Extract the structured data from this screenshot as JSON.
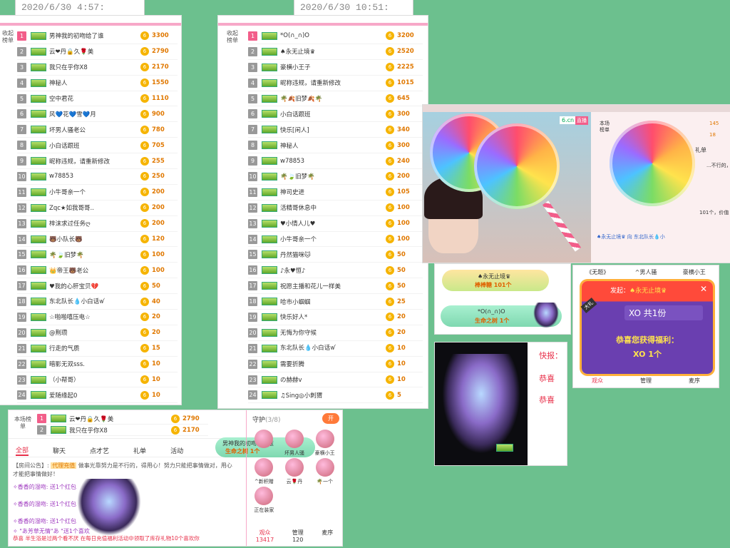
{
  "timestamps": [
    "2020/6/30 4:57:",
    "2020/6/30 10:51:"
  ],
  "rank_left": {
    "side": "收起榜单",
    "rows": [
      {
        "rank": "1",
        "name": "男神我的初吻给了谁",
        "score": "3300"
      },
      {
        "rank": "2",
        "name": "云❤丹🔒久🌹美",
        "score": "2790"
      },
      {
        "rank": "3",
        "name": "我只在乎你X8",
        "score": "2170"
      },
      {
        "rank": "4",
        "name": "神秘人",
        "score": "1550"
      },
      {
        "rank": "5",
        "name": "空中君花",
        "score": "1110"
      },
      {
        "rank": "6",
        "name": "风💙花💙雪💙月",
        "score": "900"
      },
      {
        "rank": "7",
        "name": "坏男人骚老公",
        "score": "780"
      },
      {
        "rank": "8",
        "name": "小白话跟班",
        "score": "705"
      },
      {
        "rank": "9",
        "name": "昵称违规，请重新修改",
        "score": "255"
      },
      {
        "rank": "10",
        "name": "w78853",
        "score": "250"
      },
      {
        "rank": "11",
        "name": "小牛哥亲一个",
        "score": "200"
      },
      {
        "rank": "12",
        "name": "Zqc★如我哥哥..",
        "score": "200"
      },
      {
        "rank": "13",
        "name": "梓沫求过任务ღ",
        "score": "200"
      },
      {
        "rank": "14",
        "name": "🐻小队长🐻",
        "score": "120"
      },
      {
        "rank": "15",
        "name": "🌴🍃旧梦🌴",
        "score": "100"
      },
      {
        "rank": "16",
        "name": "👑帝王🐻老公",
        "score": "100"
      },
      {
        "rank": "17",
        "name": "♥我的心肝宝贝💔",
        "score": "50"
      },
      {
        "rank": "18",
        "name": "东北队长💧小白话ꪝ",
        "score": "40"
      },
      {
        "rank": "19",
        "name": "☆啪啪嘻压电☆",
        "score": "20"
      },
      {
        "rank": "20",
        "name": "@荆瓒",
        "score": "20"
      },
      {
        "rank": "21",
        "name": "行走的气质",
        "score": "15"
      },
      {
        "rank": "22",
        "name": "暗影无双sss.",
        "score": "10"
      },
      {
        "rank": "23",
        "name": "（小帮哥）",
        "score": "10"
      },
      {
        "rank": "24",
        "name": "爱随缘起0",
        "score": "10"
      }
    ]
  },
  "rank_mid": {
    "side": "收起榜单",
    "rows": [
      {
        "rank": "1",
        "name": "*O(∩_∩)O",
        "score": "3200"
      },
      {
        "rank": "2",
        "name": "♠永无止境♛",
        "score": "2520"
      },
      {
        "rank": "3",
        "name": "豪横小王子",
        "score": "2225"
      },
      {
        "rank": "4",
        "name": "昵称违规，请重新修改",
        "score": "1015"
      },
      {
        "rank": "5",
        "name": "🌴🍂旧梦🍂🌴",
        "score": "645"
      },
      {
        "rank": "6",
        "name": "小白话跟班",
        "score": "300"
      },
      {
        "rank": "7",
        "name": "快乐[闲人]",
        "score": "340"
      },
      {
        "rank": "8",
        "name": "神秘人",
        "score": "300"
      },
      {
        "rank": "9",
        "name": "w78853",
        "score": "240"
      },
      {
        "rank": "10",
        "name": "🌴🍃旧梦🌴",
        "score": "200"
      },
      {
        "rank": "11",
        "name": "神司史进",
        "score": "105"
      },
      {
        "rank": "12",
        "name": "活精哥休息中",
        "score": "100"
      },
      {
        "rank": "13",
        "name": "♥小情人儿♥",
        "score": "100"
      },
      {
        "rank": "14",
        "name": "小牛哥亲一个",
        "score": "100"
      },
      {
        "rank": "15",
        "name": "丹然猫咪🐱",
        "score": "50"
      },
      {
        "rank": "16",
        "name": "♪永♥恒♪",
        "score": "50"
      },
      {
        "rank": "17",
        "name": "祝愿主播和花儿一样美",
        "score": "50"
      },
      {
        "rank": "18",
        "name": "哈市小蝈蝈",
        "score": "25"
      },
      {
        "rank": "19",
        "name": "快乐好人*",
        "score": "20"
      },
      {
        "rank": "20",
        "name": "无悔为你守候",
        "score": "20"
      },
      {
        "rank": "21",
        "name": "东北队长💧小白话ꪝ",
        "score": "10"
      },
      {
        "rank": "22",
        "name": "需要折腾",
        "score": "10"
      },
      {
        "rank": "23",
        "name": "の赫赫v",
        "score": "10"
      },
      {
        "rank": "24",
        "name": "♫Sing◎小刺猬",
        "score": "5"
      }
    ]
  },
  "room": {
    "side": "本场榜单",
    "top": [
      {
        "rank": "1",
        "name": "云❤丹🔒久🌹美",
        "score": "2790"
      },
      {
        "rank": "2",
        "name": "我只在乎你X8",
        "score": "2170"
      }
    ],
    "tabs": [
      "全部",
      "聊天",
      "点才艺",
      "礼单",
      "活动"
    ],
    "notice_label": "【房间公告】:",
    "notice_tag": "代理充值",
    "notice": "做事光靠努力是不行的，得用心！努力只能把事情做对，用心才能把事情做好！",
    "chats": [
      "✧香香的湿吻: 送1个红包",
      "✧香香的湿吻: 送1个红包",
      "✧香香的湿吻: 送1个红包",
      "✧ \"あ芳草无情\"あ \"送1个喜欢"
    ],
    "footer": "恭喜 半生浴是过两个看不厌 在每日充值福利活动中领取了库存礼物10个喜欢你",
    "guard_title": "守护",
    "guard_count": "(3/8)",
    "guard_btn": "开",
    "guards": [
      "",
      "坏男人骚",
      "豪横小王",
      "^新积赠",
      "云🌹丹",
      "🌴一个",
      "正在装家"
    ],
    "stats": [
      {
        "label": "观众",
        "value": "13417"
      },
      {
        "label": "管理",
        "value": "120"
      },
      {
        "label": "麦序",
        "value": ""
      }
    ],
    "popup_user": "男神我的初吻给了谁",
    "popup_gift": "生命之树 1个"
  },
  "video": {
    "logo": "6.cn",
    "live": "直播",
    "chat_side": "本场榜单",
    "chat_scores": [
      "145",
      "18"
    ],
    "chat_tab": "礼单",
    "chat_msg1": "...不行的，得",
    "chat_msg2": "101个，价值",
    "chat_user": "♠永无止境♛ 向 东北队长💧小"
  },
  "gift_small": {
    "bar1_user": "♠永无止境♛",
    "bar1_gift": "棒棒糖 101个",
    "bar2_user": "*O(∩_∩)O",
    "bar2_gift": "生命之树 1个"
  },
  "tree_panel": {
    "quick": "快报：",
    "congrats1": "恭喜",
    "congrats2": "恭喜"
  },
  "reward": {
    "tabs": [
      "《无题》",
      "^男人骚",
      "豪横小王"
    ],
    "from_label": "发起：",
    "from_user": "♠永无止境♛",
    "corner": "大礼",
    "item": "XO 共1份",
    "congrats": "恭喜您获得福利：",
    "gain": "XO 1个",
    "bottom": [
      "观众",
      "管理",
      "麦序"
    ]
  },
  "colors": {
    "green_bg": "#6cc08e",
    "pink": "#f25e8a",
    "coin": "#f6b400",
    "popup_red": "#f03a3a",
    "popup_purple": "#6a3fb0"
  }
}
